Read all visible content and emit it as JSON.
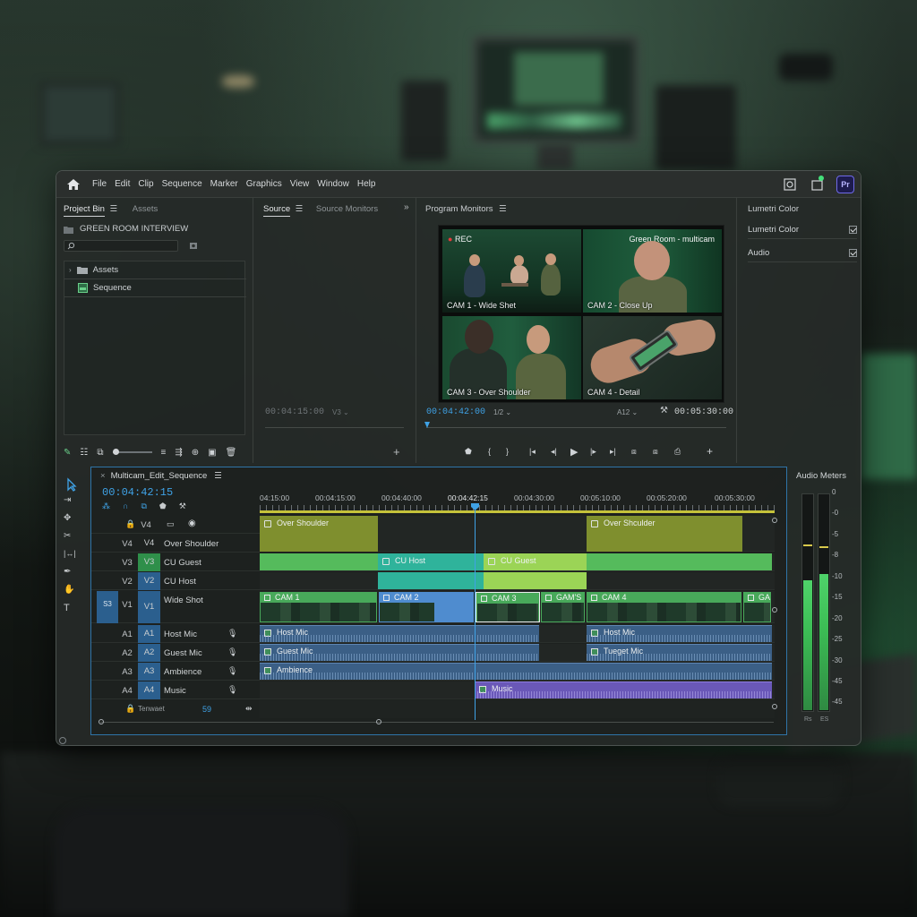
{
  "menu": [
    "File",
    "Edit",
    "Clip",
    "Sequence",
    "Marker",
    "Graphics",
    "View",
    "Window",
    "Help"
  ],
  "app_badge": "Pr",
  "project": {
    "tabs": [
      "Project Bin",
      "Assets"
    ],
    "bin_title": "GREEN ROOM INTERVIEW",
    "items": [
      "Assets",
      "Sequence"
    ]
  },
  "source": {
    "tabs": [
      "Source",
      "Source Monitors"
    ],
    "timecode": "00:04:15:00",
    "zoom": "V3"
  },
  "program": {
    "title": "Program Monitors",
    "rec": "REC",
    "overlay_title": "Green Room - multicam",
    "cams": [
      "CAM 1 - Wide Shet",
      "CAM 2 - Close Up",
      "CAM 3 - Over Shoulder",
      "CAM 4 - Detail"
    ],
    "timecode": "00:04:42:00",
    "fit": "1/2",
    "quality": "A12",
    "duration": "00:05:30:00"
  },
  "effects": {
    "title": "Lumetri Color",
    "items": [
      {
        "label": "Lumetri Color",
        "checked": true
      },
      {
        "label": "Audio",
        "checked": true
      }
    ]
  },
  "timeline": {
    "sequence_name": "Multicam_Edit_Sequence",
    "timecode": "00:04:42:15",
    "ruler": [
      "04:15:00",
      "00:04:15:00",
      "00:04:40:00",
      "00:04:42:15",
      "00:04:30:00",
      "00:05:10:00",
      "00:05:20:00",
      "00:05:30:00"
    ],
    "video_tracks": [
      {
        "id": "V4",
        "patch": "V4",
        "name": "Over Shoulder"
      },
      {
        "id": "V3",
        "patch": "V3",
        "name": "CU Guest"
      },
      {
        "id": "V2",
        "patch": "V2",
        "name": "CU Host"
      },
      {
        "id": "V1",
        "patch": "V1",
        "name": "Wide Shot",
        "source": "S3"
      }
    ],
    "audio_tracks": [
      {
        "id": "A1",
        "patch": "A1",
        "name": "Host Mic"
      },
      {
        "id": "A2",
        "patch": "A2",
        "name": "Guest Mic"
      },
      {
        "id": "A3",
        "patch": "A3",
        "name": "Ambience"
      },
      {
        "id": "A4",
        "patch": "A4",
        "name": "Music"
      }
    ],
    "header_row": "V4",
    "footer_label": "Tenwaet",
    "footer_value": "59",
    "clips": {
      "top": [
        "Over Shoulder",
        "Over Shculder"
      ],
      "v3": [
        "CU Host",
        "CU Guest"
      ],
      "v1": [
        "CAM 1",
        "CAM 2",
        "CAM 3",
        "GAM'S",
        "CAM 4",
        "GA"
      ],
      "a1": [
        "Host Mic",
        "Host Mic"
      ],
      "a2": [
        "Guest Mic",
        "Tueget Mic"
      ],
      "a3": [
        "Ambience"
      ],
      "a4": [
        "Music"
      ]
    }
  },
  "meters": {
    "title": "Audio Meters",
    "scale": [
      "0",
      "-0",
      "-5",
      "-8",
      "-10",
      "-15",
      "-20",
      "-25",
      "-30",
      "-45",
      "-45"
    ],
    "left_label": "Rs",
    "right_label": "ES",
    "levels": [
      0.6,
      0.63
    ]
  },
  "colors": {
    "accent": "#3fa2e6",
    "video_clip": "#48a95a",
    "over_shoulder_clip": "#7f8f2e",
    "audio_clip": "#3b5f86",
    "music_clip": "#6a58b8"
  }
}
